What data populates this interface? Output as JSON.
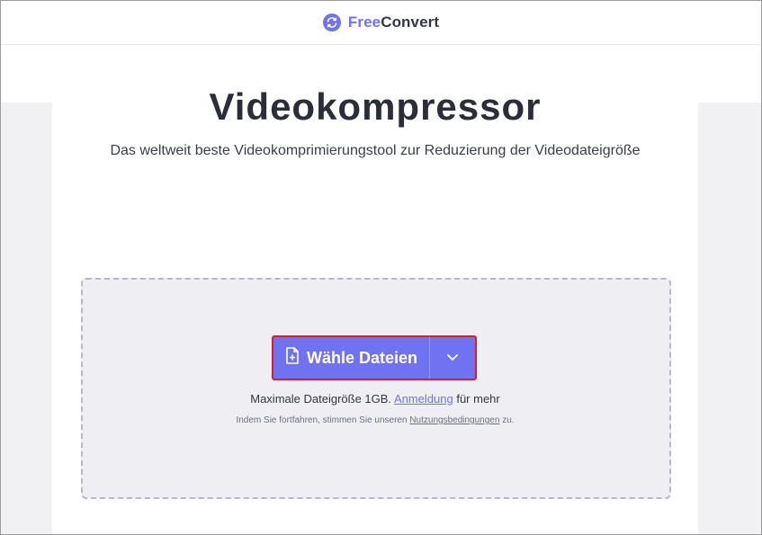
{
  "header": {
    "logo_free": "Free",
    "logo_convert": "Convert",
    "logo_icon": "refresh-icon"
  },
  "main": {
    "title": "Videokompressor",
    "subtitle": "Das weltweit beste Videokomprimierungstool zur Reduzierung der Videodateigröße"
  },
  "upload": {
    "button_label": "Wähle Dateien",
    "button_icon": "file-plus-icon",
    "dropdown_icon": "chevron-down-icon",
    "maxsize_prefix": "Maximale Dateigröße 1GB.",
    "maxsize_link": "Anmeldung",
    "maxsize_suffix": "für mehr",
    "terms_prefix": "Indem Sie fortfahren, stimmen Sie unseren",
    "terms_link": "Nutzungsbedingungen",
    "terms_suffix": "zu."
  },
  "colors": {
    "accent": "#6f73f1",
    "highlight_border": "#e01b24",
    "dropzone_bg": "#eeeef3"
  }
}
